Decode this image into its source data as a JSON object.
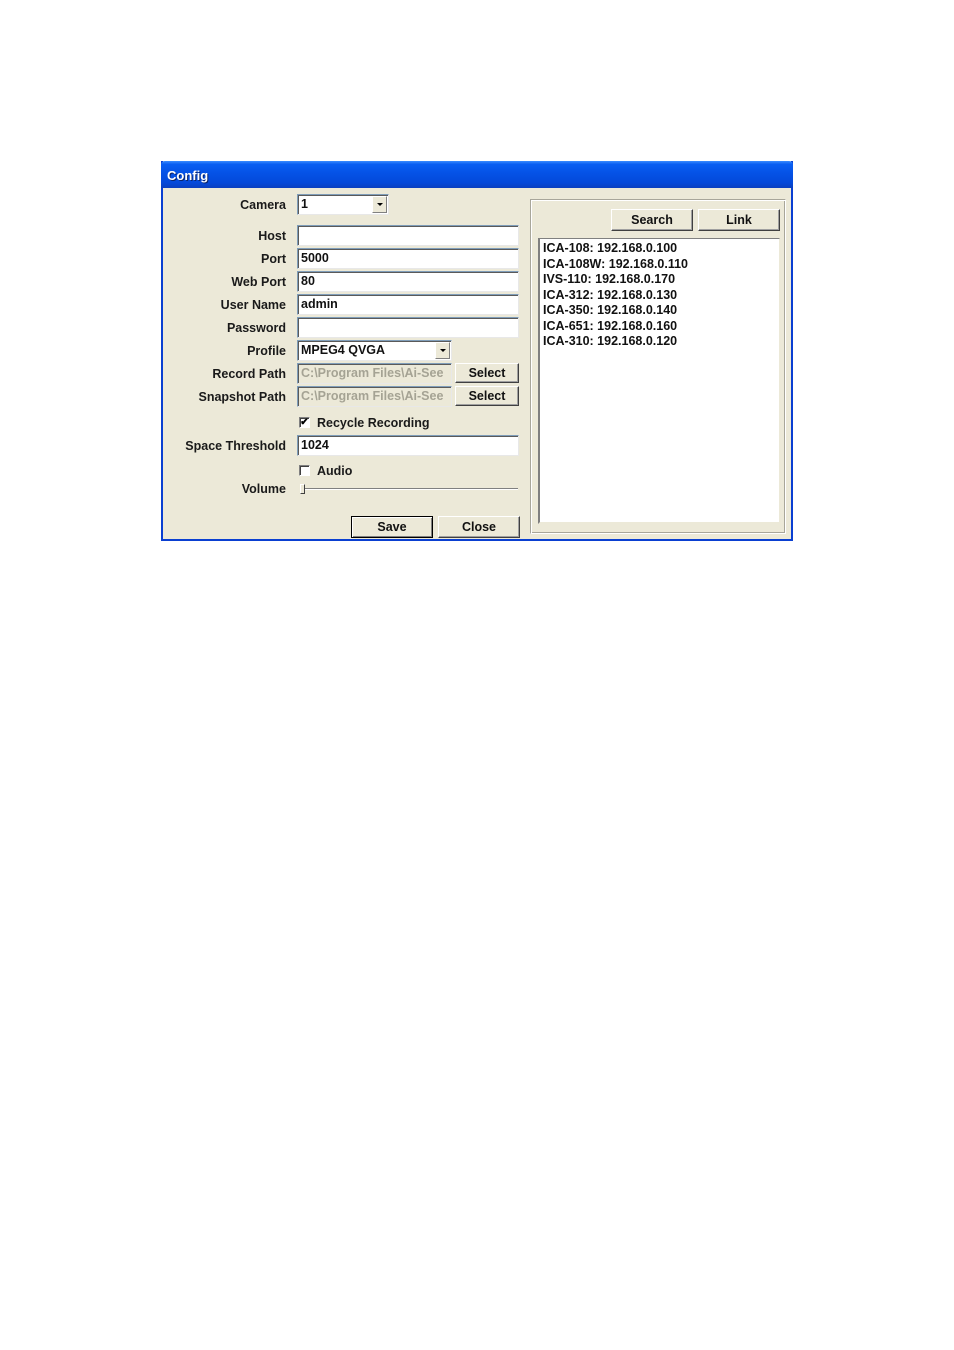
{
  "window": {
    "title": "Config"
  },
  "form": {
    "camera": {
      "label": "Camera",
      "value": "1"
    },
    "host": {
      "label": "Host",
      "value": ""
    },
    "port": {
      "label": "Port",
      "value": "5000"
    },
    "web_port": {
      "label": "Web Port",
      "value": "80"
    },
    "user_name": {
      "label": "User Name",
      "value": "admin"
    },
    "password": {
      "label": "Password",
      "value": ""
    },
    "profile": {
      "label": "Profile",
      "value": "MPEG4 QVGA"
    },
    "record_path": {
      "label": "Record Path",
      "value": "C:\\Program Files\\Ai-See",
      "button": "Select"
    },
    "snapshot_path": {
      "label": "Snapshot Path",
      "value": "C:\\Program Files\\Ai-See",
      "button": "Select"
    },
    "recycle_recording": {
      "label": "Recycle Recording",
      "checked": true,
      "check_glyph": "✔"
    },
    "space_threshold": {
      "label": "Space Threshold",
      "value": "1024"
    },
    "audio": {
      "label": "Audio",
      "checked": false
    },
    "volume": {
      "label": "Volume",
      "value_fraction": 0.0
    }
  },
  "buttons": {
    "save": "Save",
    "close": "Close",
    "search": "Search",
    "link": "Link"
  },
  "device_list": [
    "ICA-108: 192.168.0.100",
    "ICA-108W: 192.168.0.110",
    "IVS-110: 192.168.0.170",
    "ICA-312: 192.168.0.130",
    "ICA-350: 192.168.0.140",
    "ICA-651: 192.168.0.160",
    "ICA-310: 192.168.0.120"
  ]
}
